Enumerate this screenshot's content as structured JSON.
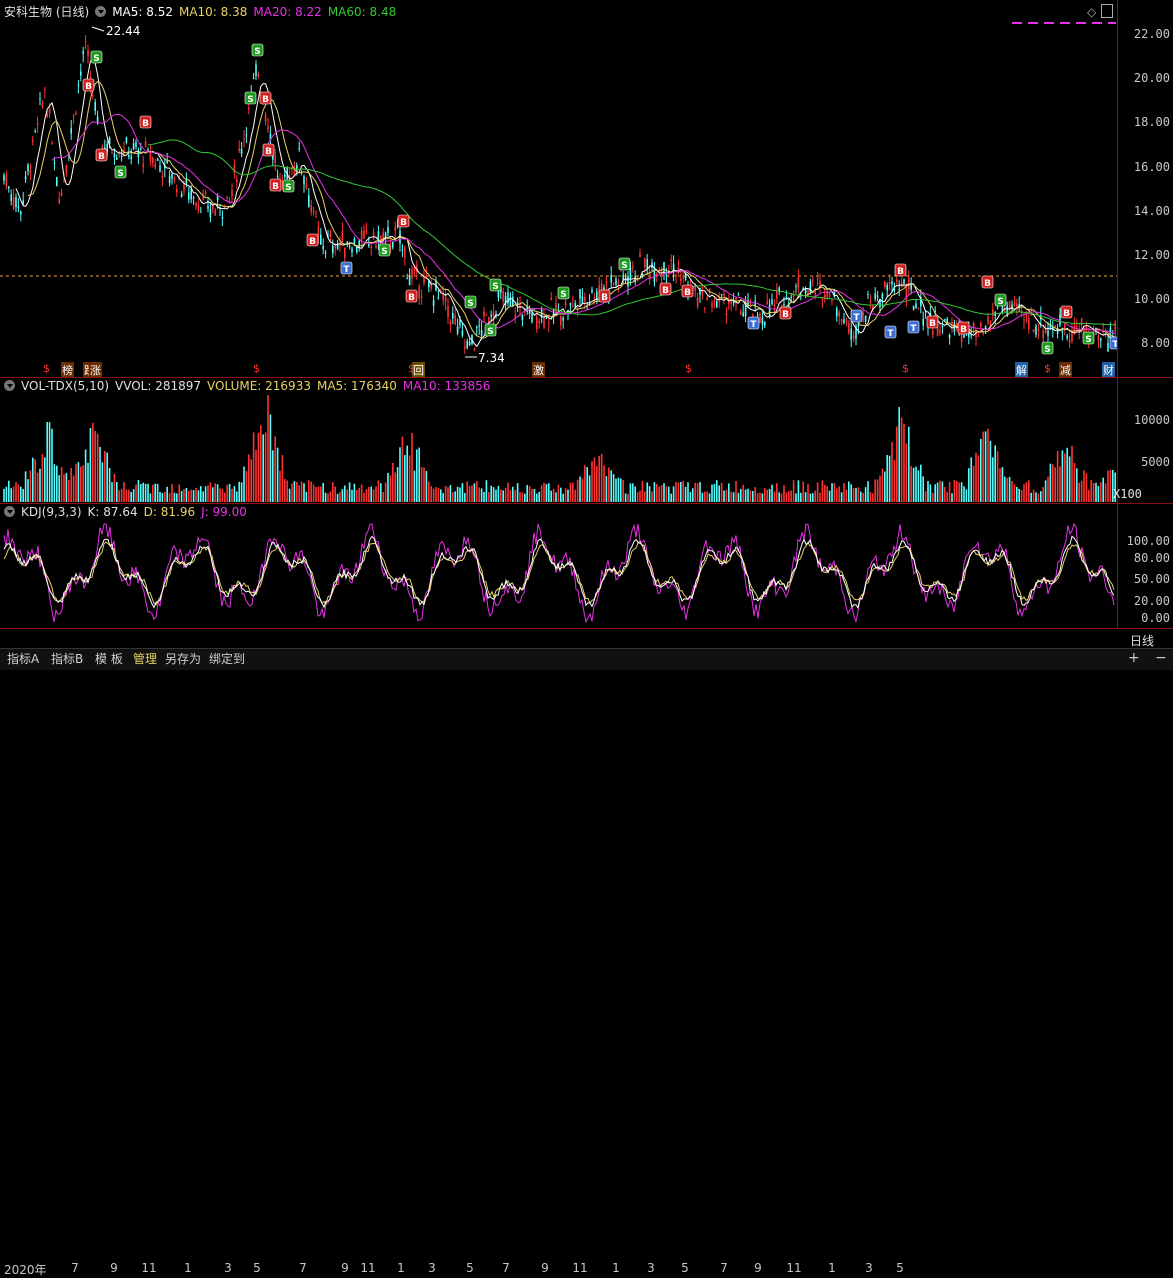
{
  "price_header": {
    "name": "安科生物 (日线)",
    "ma5": "MA5: 8.52",
    "ma10": "MA10: 8.38",
    "ma20": "MA20: 8.22",
    "ma60": "MA60: 8.48"
  },
  "price_axis": [
    "22.00",
    "20.00",
    "18.00",
    "16.00",
    "14.00",
    "12.00",
    "10.00",
    "8.00"
  ],
  "annotations": {
    "high": "22.44",
    "low": "7.34"
  },
  "event_marks": [
    "$",
    "榜",
    "跌",
    "涨",
    "$",
    "回",
    "$",
    "激",
    "$",
    "$",
    "解",
    "$",
    "减",
    "财"
  ],
  "vol_header": {
    "name": "VOL-TDX(5,10)",
    "vvol": "VVOL: 281897",
    "volume": "VOLUME: 216933",
    "ma5": "MA5: 176340",
    "ma10": "MA10: 133856"
  },
  "vol_axis": [
    "10000",
    "5000"
  ],
  "vol_unit": "X100",
  "kdj_header": {
    "name": "KDJ(9,3,3)",
    "k": "K: 87.64",
    "d": "D: 81.96",
    "j": "J: 99.00"
  },
  "kdj_axis": [
    "100.00",
    "80.00",
    "50.00",
    "20.00",
    "0.00"
  ],
  "x_axis": [
    "2020年",
    "7",
    "9",
    "11",
    "1",
    "3",
    "5",
    "7",
    "9",
    "11",
    "1",
    "3",
    "5",
    "7",
    "9",
    "11",
    "1",
    "3",
    "5",
    "7",
    "9",
    "11",
    "1",
    "3",
    "5"
  ],
  "period_label": "日线",
  "tabs": [
    "指标A",
    "指标B",
    "模 板",
    "管理",
    "另存为",
    "绑定到"
  ],
  "colors": {
    "up": "#ff3232",
    "down": "#54ffff",
    "ma5": "#ffffff",
    "ma10": "#e6d264",
    "ma20": "#e632e6",
    "ma60": "#32c832",
    "axis_line": "#8b1010"
  }
}
